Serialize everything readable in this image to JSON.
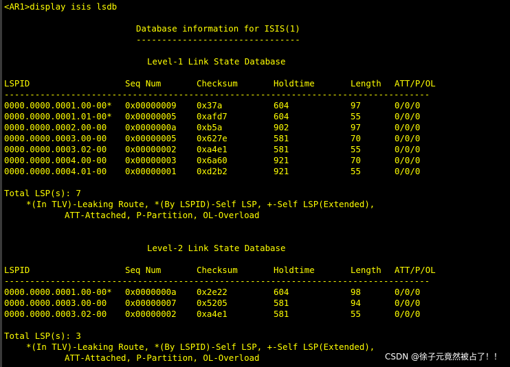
{
  "prompt": "<AR1>display isis lsdb",
  "db_title": "Database information for ISIS(1)",
  "db_title_underline": "--------------------------------",
  "columns": [
    "LSPID",
    "Seq Num",
    "Checksum",
    "Holdtime",
    "Length",
    "ATT/P/OL"
  ],
  "separator": "-----------------------------------------------------------------------------------",
  "level1": {
    "title": "Level-1 Link State Database",
    "rows": [
      [
        "0000.0000.0001.00-00*",
        "0x00000009",
        "0x37a",
        "604",
        "97",
        "0/0/0"
      ],
      [
        "0000.0000.0001.01-00*",
        "0x00000005",
        "0xafd7",
        "604",
        "55",
        "0/0/0"
      ],
      [
        "0000.0000.0002.00-00",
        "0x0000000a",
        "0xb5a",
        "902",
        "97",
        "0/0/0"
      ],
      [
        "0000.0000.0003.00-00",
        "0x00000005",
        "0x627e",
        "581",
        "70",
        "0/0/0"
      ],
      [
        "0000.0000.0003.02-00",
        "0x00000002",
        "0xa4e1",
        "581",
        "55",
        "0/0/0"
      ],
      [
        "0000.0000.0004.00-00",
        "0x00000003",
        "0x6a60",
        "921",
        "70",
        "0/0/0"
      ],
      [
        "0000.0000.0004.01-00",
        "0x00000001",
        "0xd2b2",
        "921",
        "55",
        "0/0/0"
      ]
    ],
    "total": "Total LSP(s): 7",
    "legend_line1": "*(In TLV)-Leaking Route, *(By LSPID)-Self LSP, +-Self LSP(Extended),",
    "legend_line2": "ATT-Attached, P-Partition, OL-Overload"
  },
  "level2": {
    "title": "Level-2 Link State Database",
    "rows": [
      [
        "0000.0000.0001.00-00*",
        "0x0000000a",
        "0x2e22",
        "604",
        "98",
        "0/0/0"
      ],
      [
        "0000.0000.0003.00-00",
        "0x00000007",
        "0x5205",
        "581",
        "94",
        "0/0/0"
      ],
      [
        "0000.0000.0003.02-00",
        "0x00000002",
        "0xa4e1",
        "581",
        "55",
        "0/0/0"
      ]
    ],
    "total": "Total LSP(s): 3",
    "legend_line1": "*(In TLV)-Leaking Route, *(By LSPID)-Self LSP, +-Self LSP(Extended),",
    "legend_line2": "ATT-Attached, P-Partition, OL-Overload"
  },
  "watermark": "CSDN @徐子元竟然被占了！！",
  "colors": {
    "background": "#000000",
    "text": "#ffff00",
    "watermark": "#ffffff"
  }
}
